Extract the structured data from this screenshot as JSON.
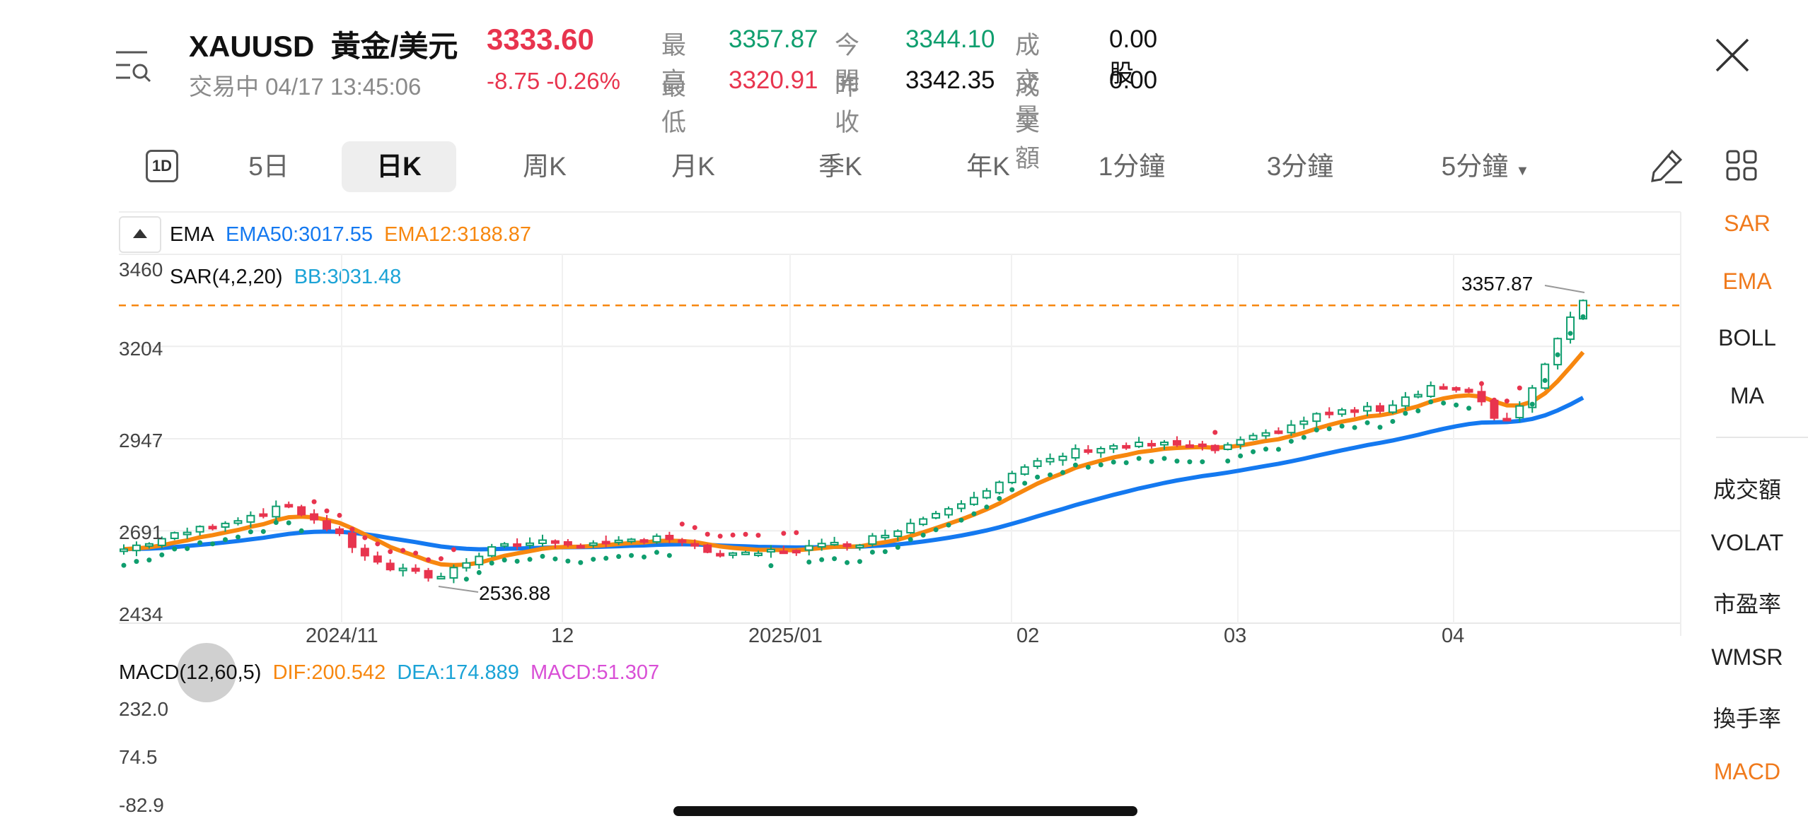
{
  "header": {
    "symbol": "XAUUSD",
    "name": "黃金/美元",
    "price": "3333.60",
    "status": "交易中 04/17 13:45:06",
    "change": "-8.75",
    "change_pct": "-0.26%",
    "quote": [
      {
        "label": "最高",
        "value": "3357.87",
        "color": "green"
      },
      {
        "label": "今開",
        "value": "3344.10",
        "color": "green"
      },
      {
        "label": "成交量",
        "value": "0.00股",
        "color": "dark"
      },
      {
        "label": "最低",
        "value": "3320.91",
        "color": "red"
      },
      {
        "label": "昨收",
        "value": "3342.35",
        "color": "dark"
      },
      {
        "label": "成交額",
        "value": "0.00",
        "color": "dark"
      }
    ]
  },
  "tabs": {
    "period_icon": "1D",
    "items": [
      "5日",
      "日K",
      "周K",
      "月K",
      "季K",
      "年K",
      "1分鐘",
      "3分鐘",
      "5分鐘"
    ],
    "active": "日K"
  },
  "side_indicators": {
    "items": [
      "SAR",
      "EMA",
      "BOLL",
      "MA",
      "成交額",
      "VOLAT",
      "市盈率",
      "WMSR",
      "換手率",
      "MACD"
    ],
    "active": [
      "SAR",
      "EMA",
      "MACD"
    ]
  },
  "main_legend": {
    "line1": {
      "ema": "EMA",
      "ema50": "EMA50:3017.55",
      "ema12": "EMA12:3188.87"
    },
    "line2": {
      "sar": "SAR(4,2,20)",
      "bb": "BB:3031.48"
    }
  },
  "macd_legend": {
    "label": "MACD(12,60,5)",
    "dif": "DIF:200.542",
    "dea": "DEA:174.889",
    "macd": "MACD:51.307"
  },
  "colors": {
    "up": "#0f9e6e",
    "down": "#e8344e",
    "ema12": "#f7870f",
    "ema50": "#1479f0",
    "dif": "#f7870f",
    "dea": "#1ba3d6",
    "macd_text": "#d94fd6"
  },
  "chart_data": [
    {
      "type": "candlestick",
      "y_ticks": [
        "3460",
        "3204",
        "2947",
        "2691",
        "2434"
      ],
      "y_range": [
        2434,
        3460
      ],
      "x_ticks": [
        "2024/11",
        "12",
        "2025/01",
        "02",
        "03",
        "04"
      ],
      "high_label": "3357.87",
      "low_label": "2536.88",
      "current_price": 3333.6,
      "ema12_last": 3188.87,
      "ema50_last": 3017.55
    },
    {
      "type": "line",
      "y_ticks": [
        "232.0",
        "74.5",
        "-82.9"
      ],
      "series": [
        {
          "name": "DIF",
          "last": 200.542
        },
        {
          "name": "DEA",
          "last": 174.889
        },
        {
          "name": "MACD",
          "last": 51.307
        }
      ]
    }
  ]
}
